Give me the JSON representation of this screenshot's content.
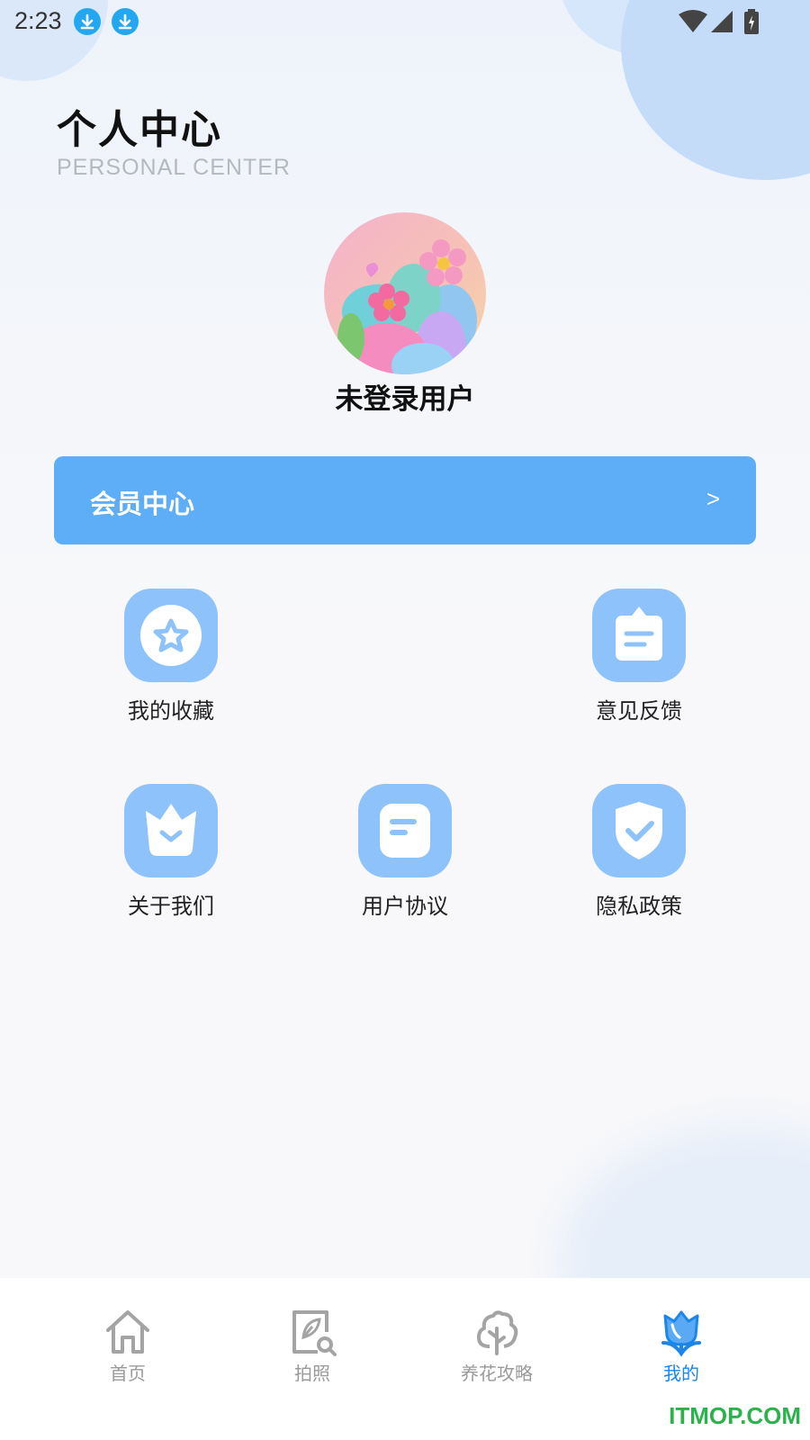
{
  "status_bar": {
    "time": "2:23"
  },
  "header": {
    "title": "个人中心",
    "subtitle": "PERSONAL CENTER"
  },
  "profile": {
    "username": "未登录用户"
  },
  "member_card": {
    "label": "会员中心",
    "arrow": ">"
  },
  "menu": {
    "favorites": "我的收藏",
    "feedback": "意见反馈",
    "about": "关于我们",
    "agreement": "用户协议",
    "privacy": "隐私政策"
  },
  "tabbar": {
    "home": "首页",
    "camera": "拍照",
    "guide": "养花攻略",
    "mine": "我的"
  },
  "watermark": "ITMOP.COM",
  "colors": {
    "accent": "#5dadf7",
    "tile": "#8ec2fb",
    "active_tab": "#1b86e8"
  }
}
